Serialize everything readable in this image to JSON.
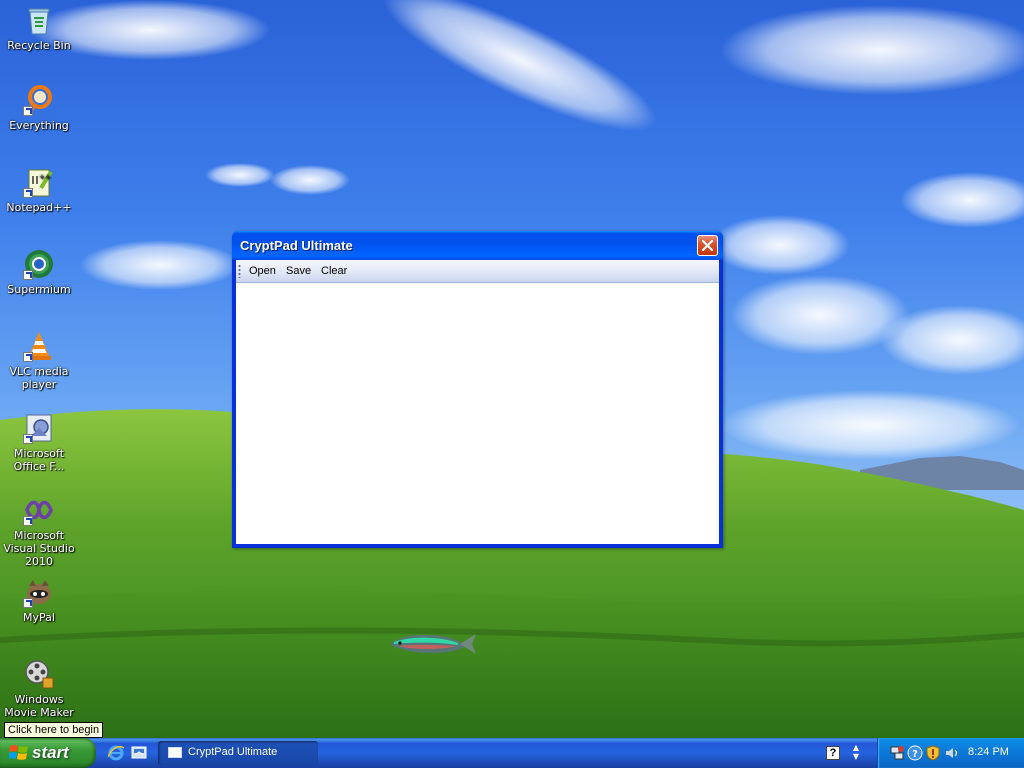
{
  "desktop": {
    "icons": [
      {
        "label": "Recycle Bin",
        "icon": "recycle-bin-icon"
      },
      {
        "label": "Everything",
        "icon": "everything-search-icon"
      },
      {
        "label": "Notepad++",
        "icon": "notepad-plus-plus-icon"
      },
      {
        "label": "Supermium",
        "icon": "supermium-browser-icon"
      },
      {
        "label": "VLC media player",
        "icon": "vlc-cone-icon"
      },
      {
        "label": "Microsoft Office F...",
        "icon": "office-picture-icon"
      },
      {
        "label": "Microsoft Visual Studio 2010",
        "icon": "visual-studio-icon"
      },
      {
        "label": "MyPal",
        "icon": "mypal-browser-icon"
      },
      {
        "label": "Windows Movie Maker",
        "icon": "movie-maker-icon"
      }
    ]
  },
  "window": {
    "title": "CryptPad Ultimate",
    "close_icon": "close-icon",
    "menu": {
      "open_label": "Open",
      "save_label": "Save",
      "clear_label": "Clear"
    },
    "editor_text": ""
  },
  "tooltip": {
    "text": "Click here to begin"
  },
  "taskbar": {
    "start_label": "start",
    "quick_launch": [
      "internet-explorer-icon",
      "show-desktop-icon"
    ],
    "task_label": "CryptPad Ultimate",
    "help_label": "?",
    "tray_icons": [
      "network-icon",
      "help-tray-icon",
      "security-shield-icon",
      "volume-icon"
    ],
    "clock": "8:24 PM"
  },
  "colors": {
    "titlebar_blue": "#0053ee",
    "start_green": "#389a36",
    "taskbar_blue": "#2157d7",
    "tray_blue": "#0b77d7",
    "close_red": "#d8532c"
  }
}
